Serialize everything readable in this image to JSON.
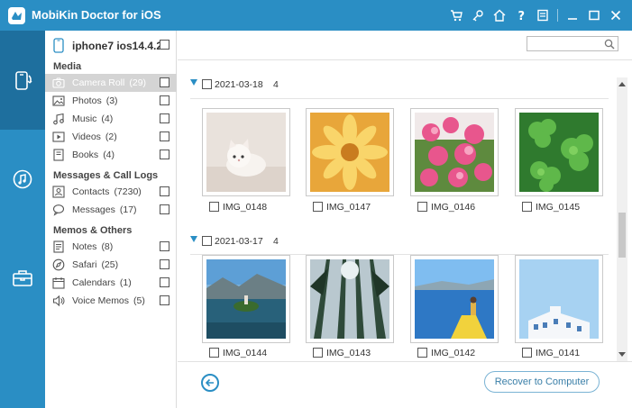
{
  "app": {
    "title": "MobiKin Doctor for iOS"
  },
  "titlebar": {
    "icons": [
      "cart-icon",
      "key-icon",
      "home-icon",
      "help-icon",
      "feedback-icon",
      "minimize-icon",
      "maximize-icon",
      "close-icon"
    ]
  },
  "device": {
    "name": "iphone7 ios14.4.2"
  },
  "sidebar": {
    "sections": [
      {
        "title": "Media",
        "items": [
          {
            "label": "Camera Roll",
            "count": "(29)",
            "icon": "camera-icon",
            "active": true
          },
          {
            "label": "Photos",
            "count": "(3)",
            "icon": "photo-icon"
          },
          {
            "label": "Music",
            "count": "(4)",
            "icon": "music-icon"
          },
          {
            "label": "Videos",
            "count": "(2)",
            "icon": "video-icon"
          },
          {
            "label": "Books",
            "count": "(4)",
            "icon": "book-icon"
          }
        ]
      },
      {
        "title": "Messages & Call Logs",
        "items": [
          {
            "label": "Contacts",
            "count": "(7230)",
            "icon": "contacts-icon"
          },
          {
            "label": "Messages",
            "count": "(17)",
            "icon": "message-icon"
          }
        ]
      },
      {
        "title": "Memos & Others",
        "items": [
          {
            "label": "Notes",
            "count": "(8)",
            "icon": "notes-icon"
          },
          {
            "label": "Safari",
            "count": "(25)",
            "icon": "safari-icon"
          },
          {
            "label": "Calendars",
            "count": "(1)",
            "icon": "calendar-icon"
          },
          {
            "label": "Voice Memos",
            "count": "(5)",
            "icon": "voice-memo-icon"
          }
        ]
      }
    ]
  },
  "search": {
    "placeholder": ""
  },
  "groups": [
    {
      "date": "2021-03-18",
      "count": "4",
      "photos": [
        "IMG_0148",
        "IMG_0147",
        "IMG_0146",
        "IMG_0145"
      ]
    },
    {
      "date": "2021-03-17",
      "count": "4",
      "photos": [
        "IMG_0144",
        "IMG_0143",
        "IMG_0142",
        "IMG_0141"
      ]
    }
  ],
  "footer": {
    "recover_label": "Recover to Computer"
  },
  "colors": {
    "accent": "#2a8ec4",
    "accent_dark": "#1e6f9e",
    "active_row": "#d4d4d4"
  }
}
